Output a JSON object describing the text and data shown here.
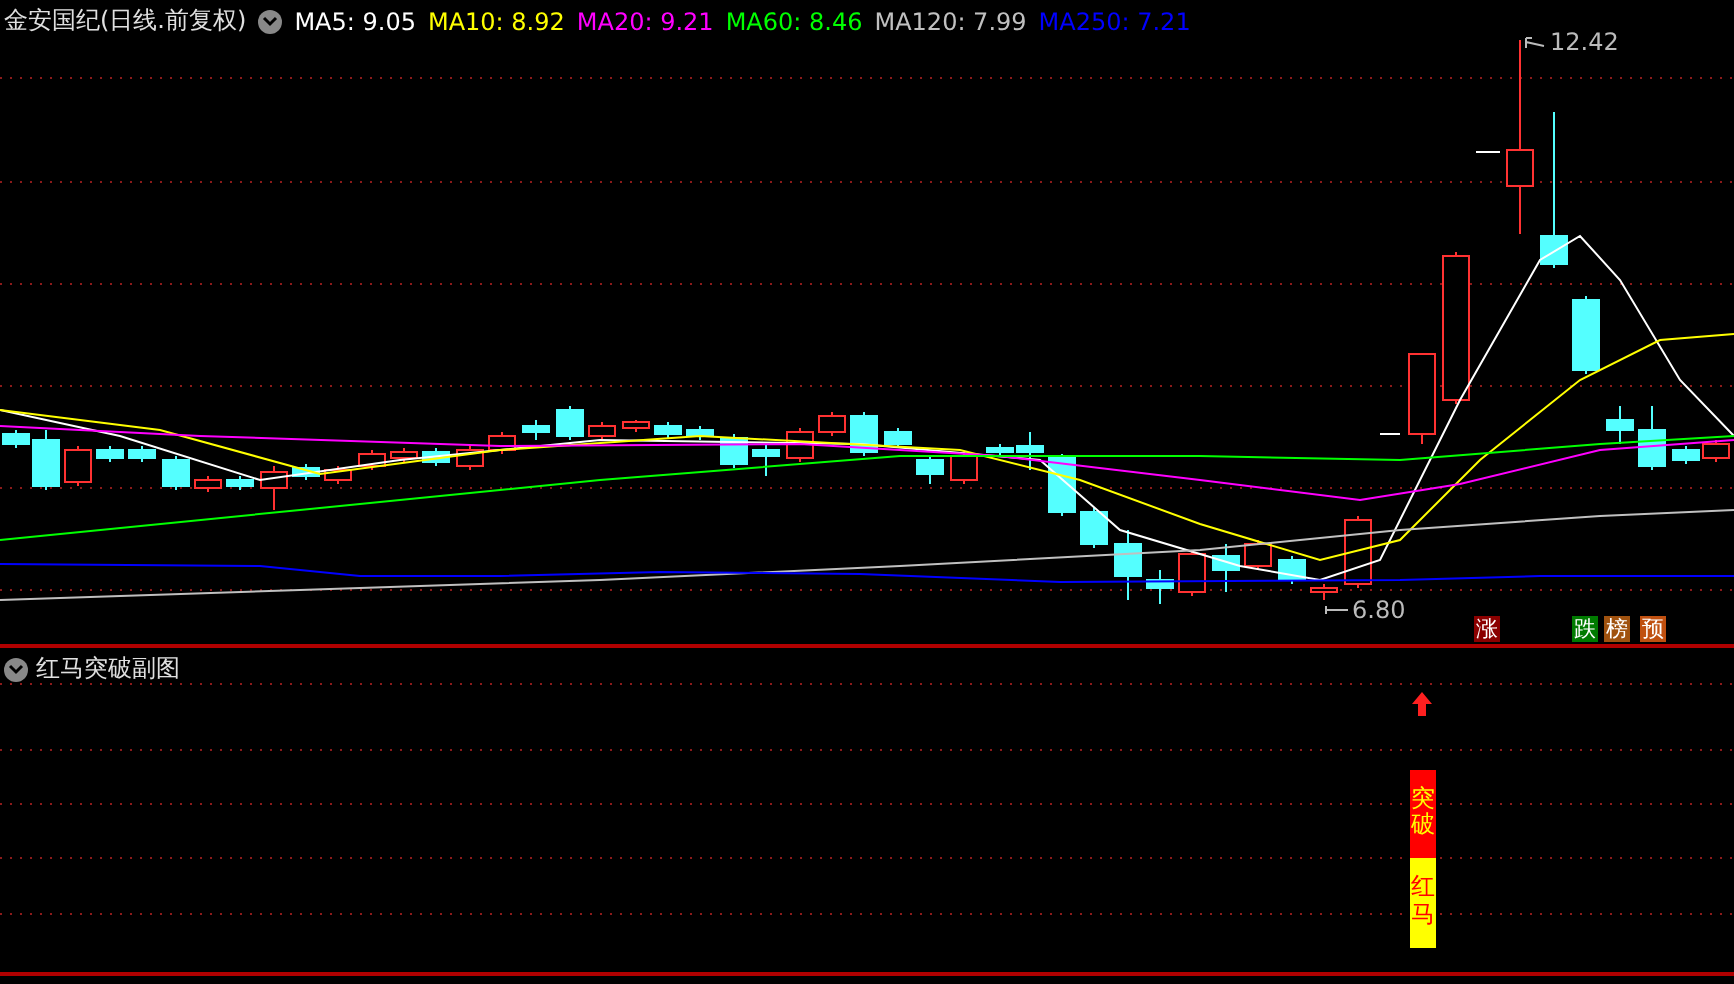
{
  "stock_title": "金安国纪(日线.前复权)",
  "ma_labels": [
    {
      "text": "MA5: 9.05",
      "color": "#ffffff"
    },
    {
      "text": "MA10: 8.92",
      "color": "#ffff00"
    },
    {
      "text": "MA20: 9.21",
      "color": "#ff00ff"
    },
    {
      "text": "MA60: 8.46",
      "color": "#00ff00"
    },
    {
      "text": "MA120: 7.99",
      "color": "#c0c0c0"
    },
    {
      "text": "MA250: 7.21",
      "color": "#0000ff"
    }
  ],
  "high_label": "12.42",
  "low_label": "6.80",
  "signal_tags": [
    {
      "text": "涨",
      "color": "#8b0000"
    },
    {
      "text": "跌",
      "color": "#007a00"
    },
    {
      "text": "榜",
      "color": "#a0520f"
    },
    {
      "text": "预",
      "color": "#c05010"
    }
  ],
  "sub_chart": {
    "title": "红马突破副图",
    "signal_bar": [
      {
        "text": "突破",
        "color": "#ff0000"
      },
      {
        "text": "红马",
        "color": "#ffff00"
      }
    ]
  }
}
